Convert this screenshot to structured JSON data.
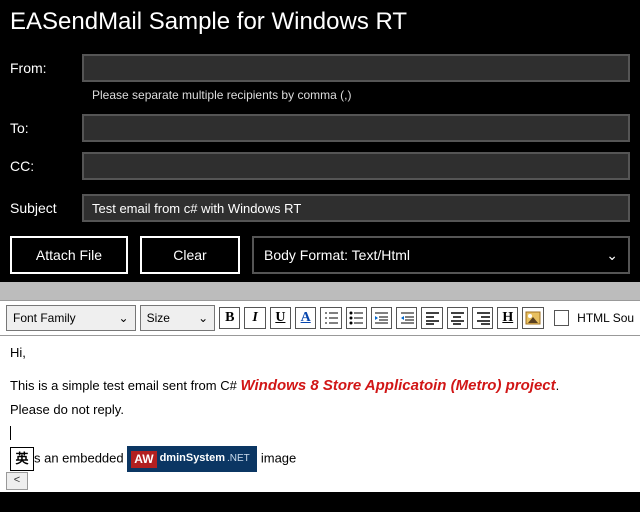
{
  "header": {
    "title": "EASendMail Sample for Windows RT"
  },
  "fields": {
    "from_label": "From:",
    "from_value": "",
    "help_text": "Please separate multiple recipients by comma (,)",
    "to_label": "To:",
    "to_value": "",
    "cc_label": "CC:",
    "cc_value": "",
    "subject_label": "Subject",
    "subject_value": "Test email from c# with Windows RT"
  },
  "buttons": {
    "attach": "Attach File",
    "clear": "Clear",
    "body_format": "Body Format: Text/Html"
  },
  "toolbar": {
    "font_family": "Font Family",
    "size": "Size",
    "html_source": "HTML Sou",
    "icons": {
      "bold": "B",
      "italic": "I",
      "underline": "U",
      "fontcolor": "A"
    }
  },
  "body": {
    "greeting": "Hi,",
    "line1a": "This is a simple test email sent from C# ",
    "line1b": "Windows 8 Store Applicatoin (Metro) project",
    "line1c": ".",
    "line2": "Please do not reply.",
    "ime": "英",
    "embed_a": "s an embedded ",
    "embed_b": " image",
    "logo": {
      "aw": "AW",
      "name": "dminSystem",
      "net": ".NET"
    }
  }
}
